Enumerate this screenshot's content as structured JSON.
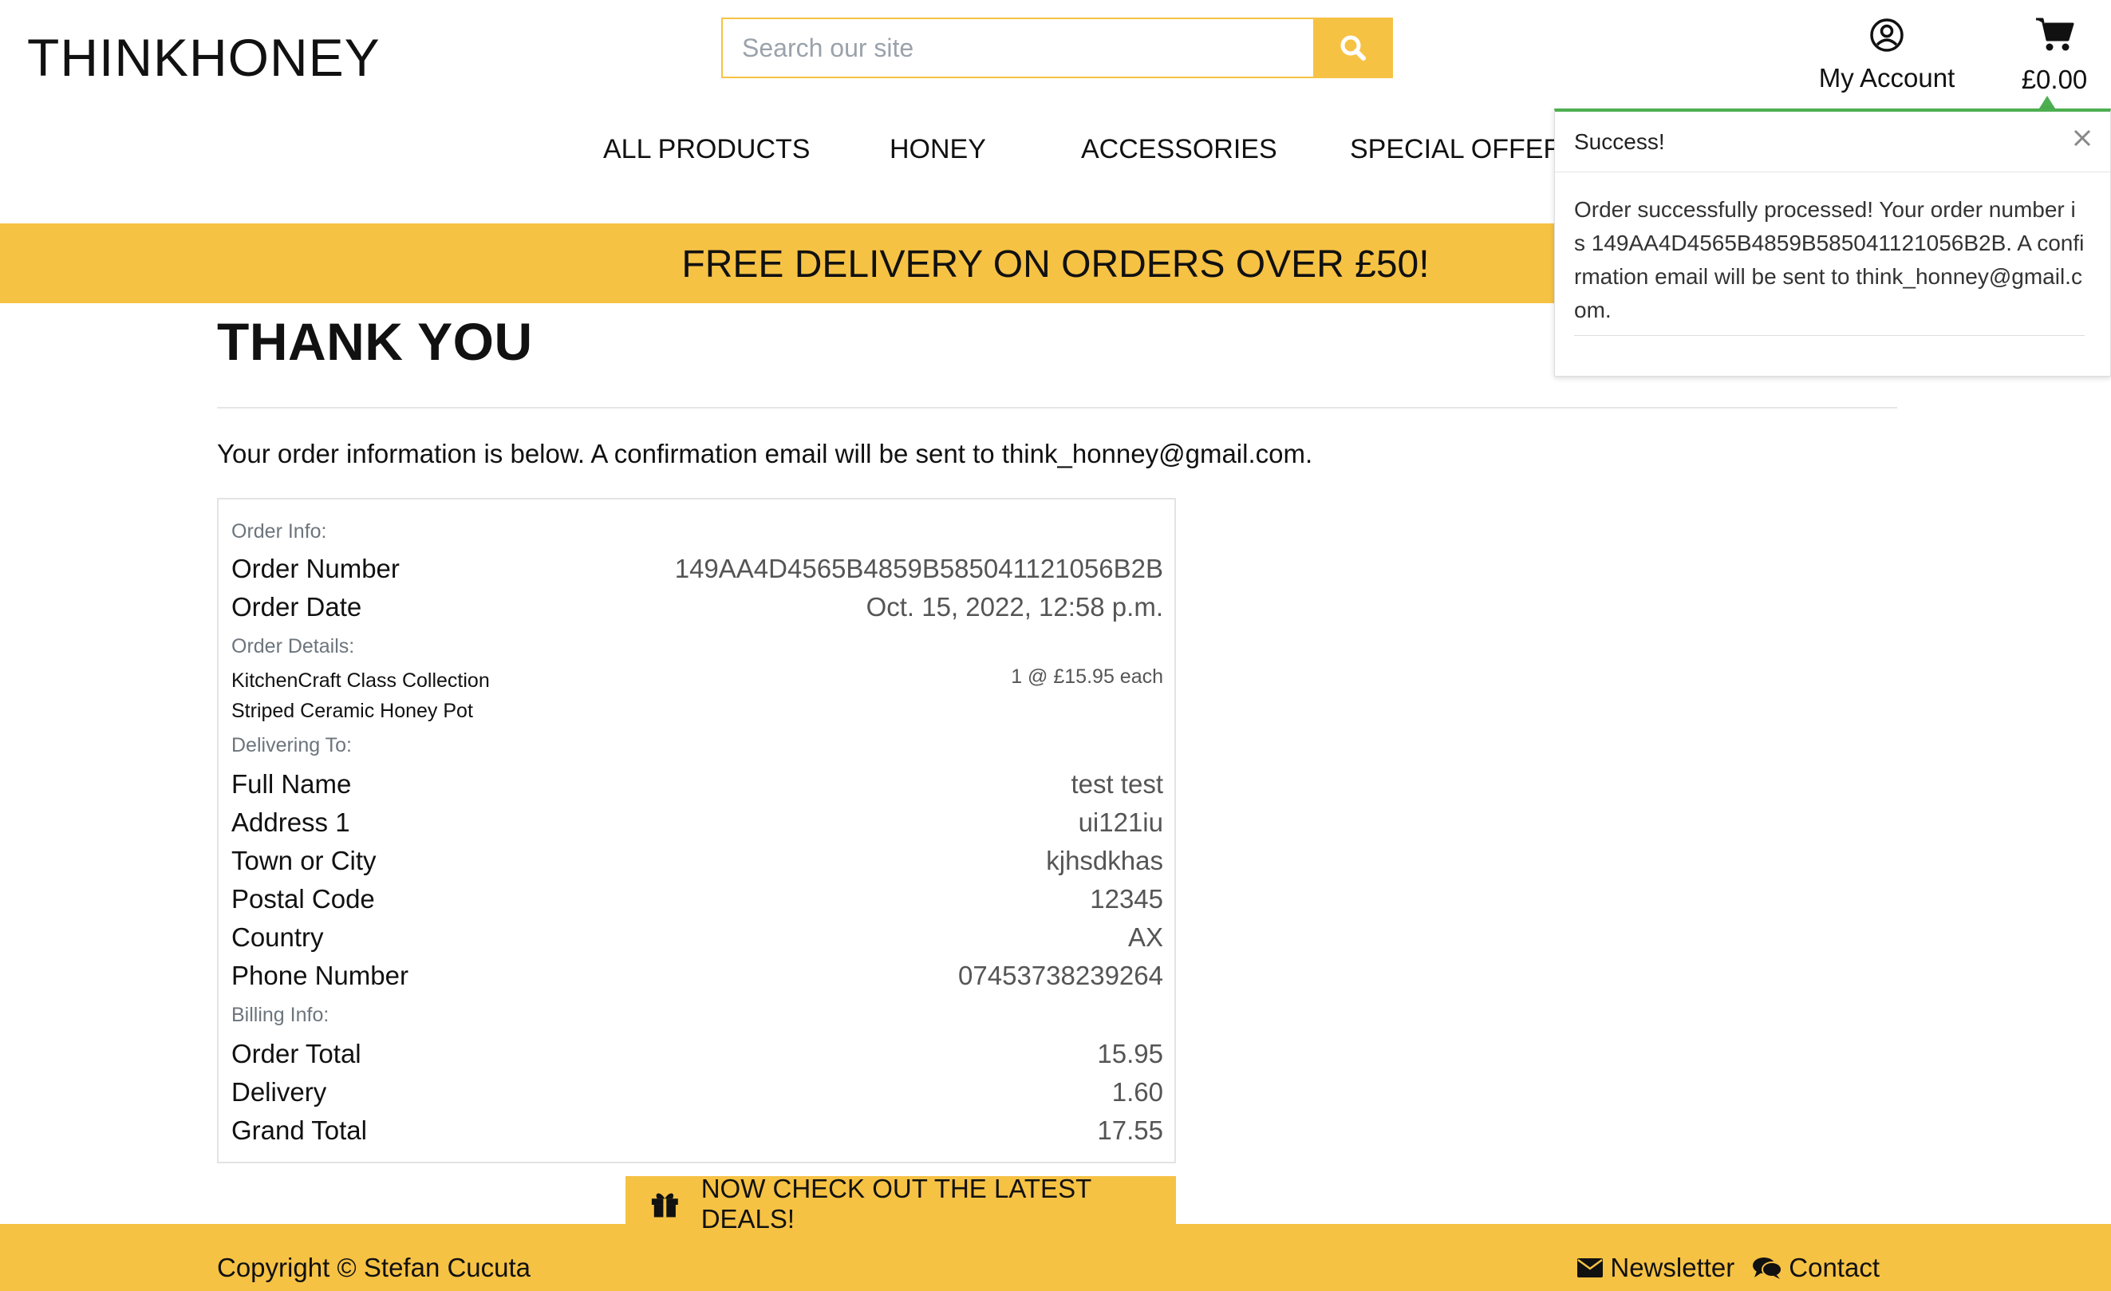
{
  "header": {
    "brand": "THINKHONEY",
    "search_placeholder": "Search our site",
    "account_label": "My Account",
    "cart_total": "£0.00"
  },
  "nav": {
    "items": [
      "ALL PRODUCTS",
      "HONEY",
      "ACCESSORIES",
      "SPECIAL OFFERS"
    ]
  },
  "banner": {
    "text": "FREE DELIVERY ON ORDERS OVER £50!"
  },
  "toast": {
    "title": "Success!",
    "message": "Order successfully processed! Your order number is 149AA4D4565B4859B585041121056B2B. A confirmation email will be sent to think_honney@gmail.com."
  },
  "main": {
    "title": "THANK YOU",
    "intro": "Your order information is below. A confirmation email will be sent to think_honney@gmail.com."
  },
  "order": {
    "info_heading": "Order Info:",
    "number_label": "Order Number",
    "number_value": "149AA4D4565B4859B585041121056B2B",
    "date_label": "Order Date",
    "date_value": "Oct. 15, 2022, 12:58 p.m.",
    "details_heading": "Order Details:",
    "item_name_line1": "KitchenCraft Class Collection",
    "item_name_line2": "Striped Ceramic Honey Pot",
    "item_qty": "1 @ £15.95 each",
    "delivery_heading": "Delivering To:",
    "full_name_label": "Full Name",
    "full_name_value": "test test",
    "address1_label": "Address 1",
    "address1_value": "ui121iu",
    "town_label": "Town or City",
    "town_value": "kjhsdkhas",
    "postal_label": "Postal Code",
    "postal_value": "12345",
    "country_label": "Country",
    "country_value": "AX",
    "phone_label": "Phone Number",
    "phone_value": "07453738239264",
    "billing_heading": "Billing Info:",
    "order_total_label": "Order Total",
    "order_total_value": "15.95",
    "delivery_label": "Delivery",
    "delivery_value": "1.60",
    "grand_total_label": "Grand Total",
    "grand_total_value": "17.55"
  },
  "deals_button": {
    "label": "NOW CHECK OUT THE LATEST DEALS!"
  },
  "footer": {
    "copyright": "Copyright © Stefan Cucuta",
    "newsletter": "Newsletter",
    "contact": "Contact"
  },
  "colors": {
    "accent": "#f6c244",
    "success": "#4caf50"
  },
  "icons": [
    "search-icon",
    "user-circle-icon",
    "shopping-cart-icon",
    "close-icon",
    "gift-icon",
    "envelope-icon",
    "comments-icon"
  ]
}
